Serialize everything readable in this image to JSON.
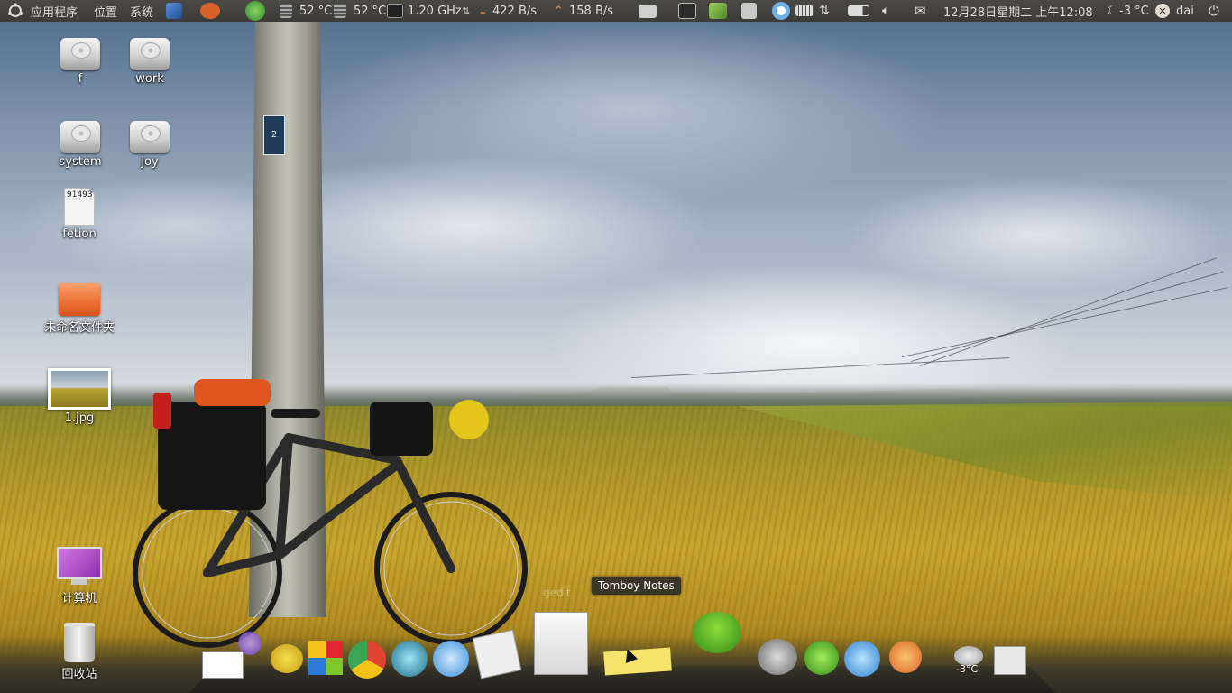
{
  "top_panel": {
    "menus": [
      "应用程序",
      "位置",
      "系统"
    ],
    "cpu_temp_1": "52 °C",
    "cpu_temp_2": "52 °C",
    "cpu_freq": "1.20 GHz",
    "net_down": "422 B/s",
    "net_up": "158 B/s",
    "datetime": "12月28日星期二 上午12:08",
    "weather_temp": "-3 °C",
    "user": "dai"
  },
  "desktop": {
    "icons": [
      {
        "label": "f"
      },
      {
        "label": "work"
      },
      {
        "label": "system"
      },
      {
        "label": "joy"
      },
      {
        "label": "fetion",
        "file_text": "91493"
      },
      {
        "label": "未命名文件夹"
      },
      {
        "label": "1.jpg"
      },
      {
        "label": "计算机"
      },
      {
        "label": "回收站"
      }
    ]
  },
  "wallpaper": {
    "pole_tag": "2"
  },
  "dock": {
    "tooltip": "Tomboy Notes",
    "ghost_label_1": "gedit",
    "weather_label": "-3°C"
  },
  "colors": {
    "panel_bg": "#3c3b37",
    "folder": "#ec6e33"
  }
}
